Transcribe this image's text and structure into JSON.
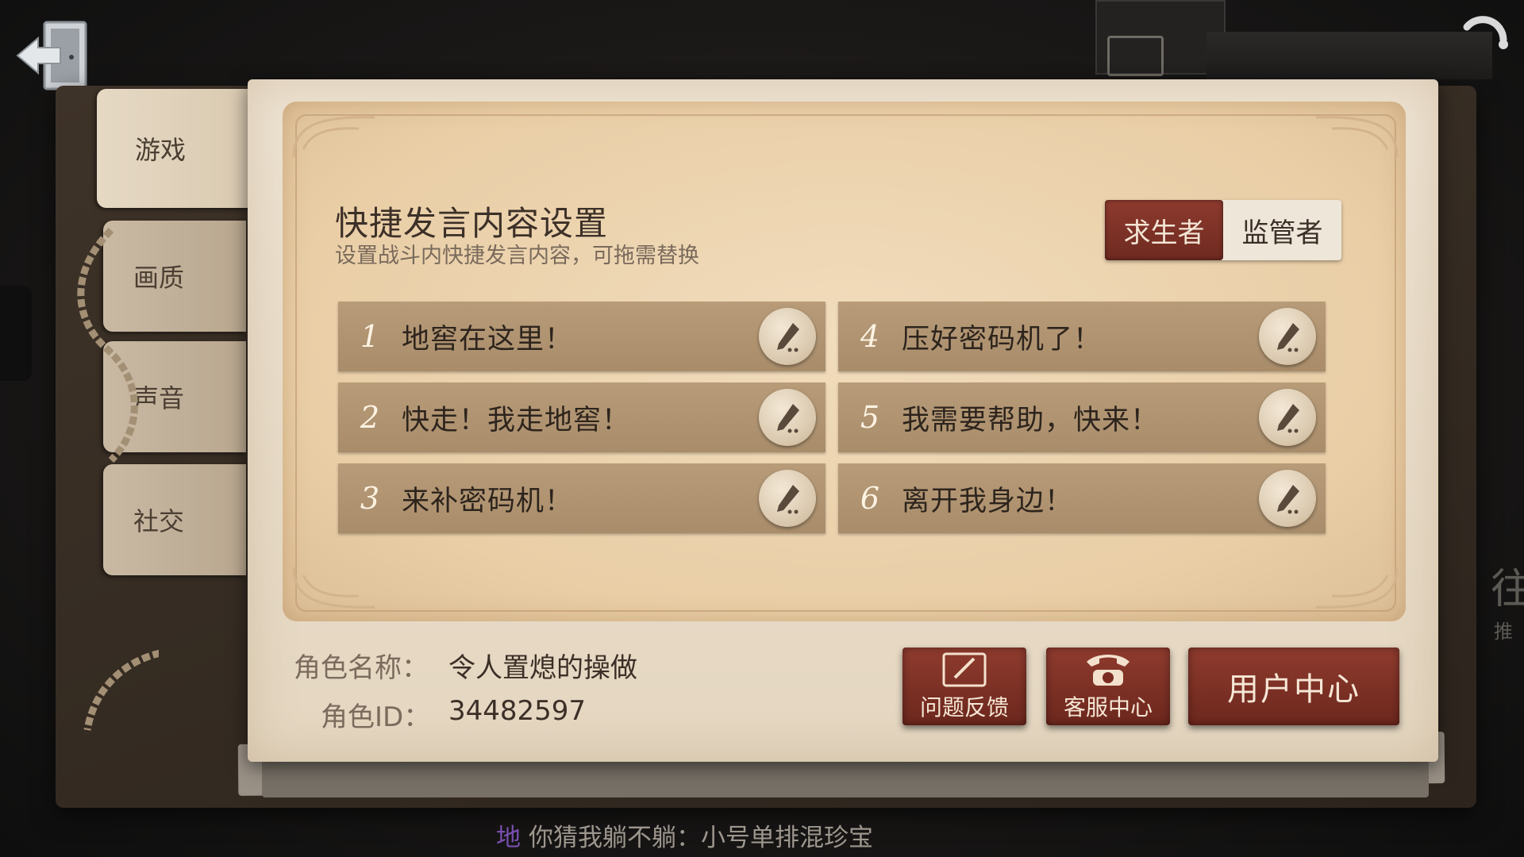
{
  "sidebar": {
    "tabs": [
      {
        "label": "游戏",
        "active": true
      },
      {
        "label": "画质",
        "active": false
      },
      {
        "label": "声音",
        "active": false
      },
      {
        "label": "社交",
        "active": false
      }
    ]
  },
  "panel": {
    "title": "快捷发言内容设置",
    "subtitle": "设置战斗内快捷发言内容，可拖需替换"
  },
  "role_toggle": {
    "survivor_label": "求生者",
    "hunter_label": "监管者",
    "selected": "求生者"
  },
  "phrases": [
    {
      "number": "1",
      "text": "地窖在这里！"
    },
    {
      "number": "2",
      "text": "快走！我走地窖！"
    },
    {
      "number": "3",
      "text": "来补密码机！"
    },
    {
      "number": "4",
      "text": "压好密码机了！"
    },
    {
      "number": "5",
      "text": "我需要帮助，快来！"
    },
    {
      "number": "6",
      "text": "离开我身边！"
    }
  ],
  "character": {
    "name_label": "角色名称：",
    "name_value": "令人置熄的操做",
    "id_label": "角色ID：",
    "id_value": "34482597"
  },
  "buttons": {
    "feedback_label": "问题反馈",
    "service_label": "客服中心",
    "user_center_label": "用户中心"
  },
  "chat": {
    "channel": "地",
    "message": "你猜我躺不躺：小号单排混珍宝"
  },
  "colors": {
    "accent_red": "#7e3226",
    "phrase_bar": "#b09473",
    "card_bg": "#e9ddc9"
  }
}
